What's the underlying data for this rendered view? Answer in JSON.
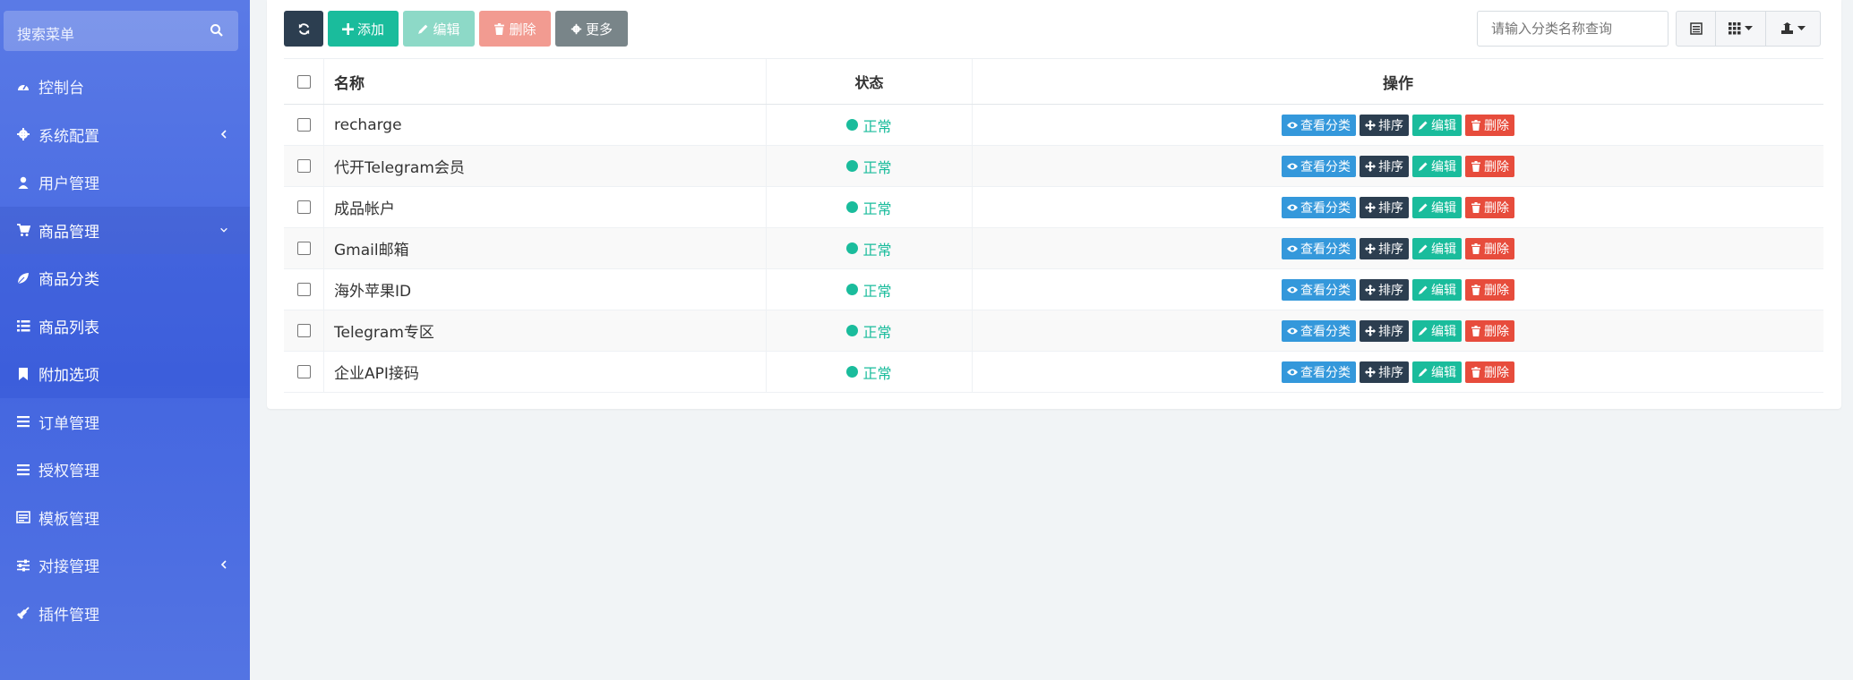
{
  "sidebar": {
    "search_placeholder": "搜索菜单",
    "items": [
      {
        "label": "控制台",
        "icon": "dashboard-icon"
      },
      {
        "label": "系统配置",
        "icon": "gear-icon",
        "has_chevron": "left"
      },
      {
        "label": "用户管理",
        "icon": "user-icon"
      },
      {
        "label": "商品管理",
        "icon": "cart-icon",
        "has_chevron": "down"
      },
      {
        "label": "商品分类",
        "icon": "leaf-icon"
      },
      {
        "label": "商品列表",
        "icon": "list-icon"
      },
      {
        "label": "附加选项",
        "icon": "bookmark-icon"
      },
      {
        "label": "订单管理",
        "icon": "bars-icon"
      },
      {
        "label": "授权管理",
        "icon": "bars-icon"
      },
      {
        "label": "模板管理",
        "icon": "template-icon"
      },
      {
        "label": "对接管理",
        "icon": "sliders-icon",
        "has_chevron": "left"
      },
      {
        "label": "插件管理",
        "icon": "plug-icon"
      }
    ]
  },
  "toolbar": {
    "add_label": "添加",
    "edit_label": "编辑",
    "delete_label": "删除",
    "more_label": "更多",
    "search_placeholder": "请输入分类名称查询"
  },
  "table": {
    "headers": {
      "name": "名称",
      "status": "状态",
      "ops": "操作"
    },
    "rows": [
      {
        "name": "recharge",
        "status": "正常"
      },
      {
        "name": "代开Telegram会员",
        "status": "正常"
      },
      {
        "name": "成品帐户",
        "status": "正常"
      },
      {
        "name": "Gmail邮箱",
        "status": "正常"
      },
      {
        "name": "海外苹果ID",
        "status": "正常"
      },
      {
        "name": "Telegram专区",
        "status": "正常"
      },
      {
        "name": "企业API接码",
        "status": "正常"
      }
    ],
    "row_actions": {
      "view": "查看分类",
      "sort": "排序",
      "edit": "编辑",
      "delete": "删除"
    }
  },
  "colors": {
    "sidebar": "#4a6ce2",
    "primary_dark": "#2c3e50",
    "success": "#1abc9c",
    "danger": "#e74c3c",
    "info": "#3498db"
  }
}
